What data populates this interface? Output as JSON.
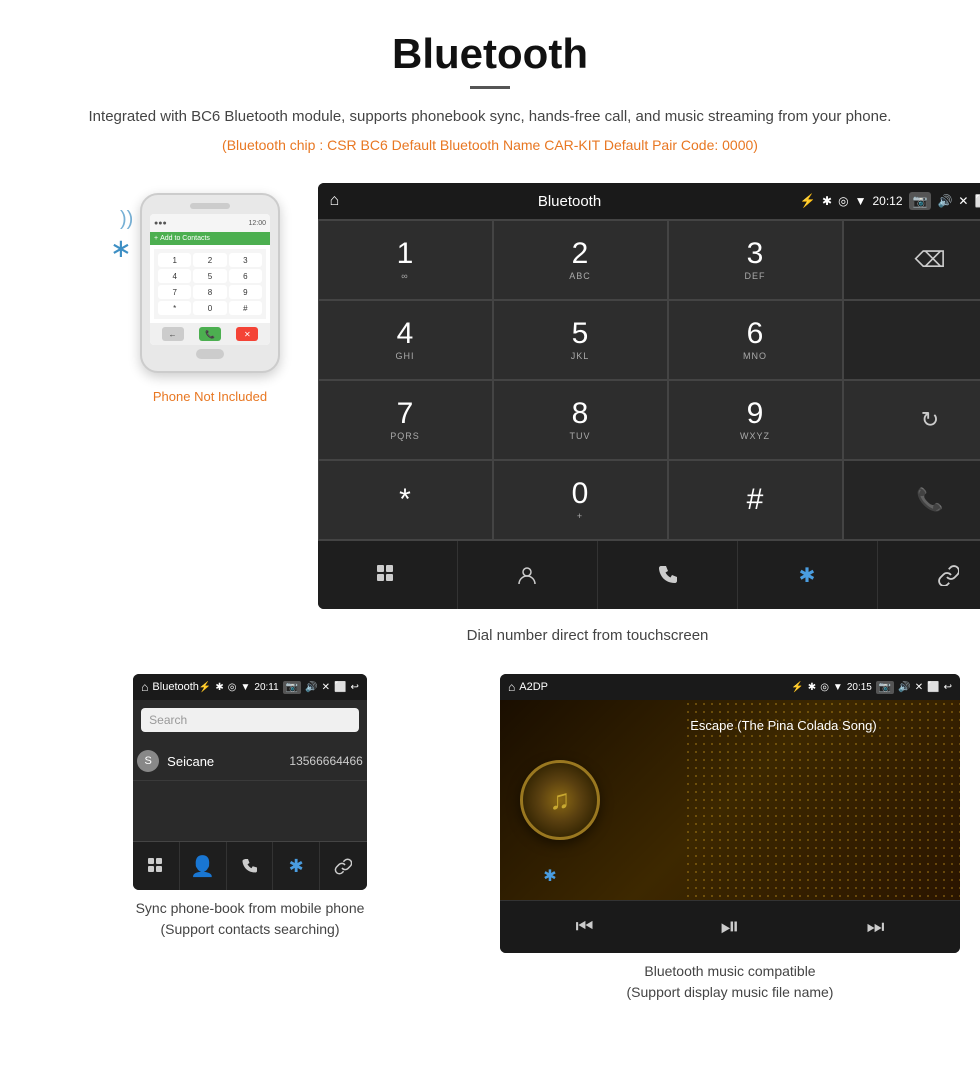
{
  "page": {
    "title": "Bluetooth",
    "description": "Integrated with BC6 Bluetooth module, supports phonebook sync, hands-free call, and music streaming from your phone.",
    "specs_line": "(Bluetooth chip : CSR BC6    Default Bluetooth Name CAR-KIT    Default Pair Code: 0000)"
  },
  "main_screen": {
    "status_bar": {
      "title": "Bluetooth",
      "time": "20:12",
      "usb_icon": "⚡",
      "back_icon": "↩"
    },
    "dialpad": [
      {
        "number": "1",
        "letters": "∞",
        "type": "digit"
      },
      {
        "number": "2",
        "letters": "ABC",
        "type": "digit"
      },
      {
        "number": "3",
        "letters": "DEF",
        "type": "digit"
      },
      {
        "number": "",
        "letters": "",
        "type": "empty"
      },
      {
        "number": "4",
        "letters": "GHI",
        "type": "digit"
      },
      {
        "number": "5",
        "letters": "JKL",
        "type": "digit"
      },
      {
        "number": "6",
        "letters": "MNO",
        "type": "digit"
      },
      {
        "number": "",
        "letters": "",
        "type": "empty"
      },
      {
        "number": "7",
        "letters": "PQRS",
        "type": "digit"
      },
      {
        "number": "8",
        "letters": "TUV",
        "type": "digit"
      },
      {
        "number": "9",
        "letters": "WXYZ",
        "type": "digit"
      },
      {
        "number": "",
        "letters": "",
        "type": "action_refresh"
      },
      {
        "number": "*",
        "letters": "",
        "type": "digit"
      },
      {
        "number": "0",
        "letters": "+",
        "type": "digit_plus"
      },
      {
        "number": "#",
        "letters": "",
        "type": "digit"
      },
      {
        "number": "",
        "letters": "",
        "type": "action_call_green"
      }
    ],
    "toolbar": [
      {
        "icon": "⠿",
        "name": "grid-icon"
      },
      {
        "icon": "👤",
        "name": "contact-icon"
      },
      {
        "icon": "📞",
        "name": "phone-icon"
      },
      {
        "icon": "✱",
        "name": "bluetooth-icon"
      },
      {
        "icon": "🔗",
        "name": "link-icon"
      }
    ],
    "caption": "Dial number direct from touchscreen"
  },
  "phone_mockup": {
    "not_included": "Phone Not Included"
  },
  "bottom_left": {
    "status_title": "Bluetooth",
    "time": "20:11",
    "search_placeholder": "Search",
    "contact_letter": "S",
    "contact_name": "Seicane",
    "contact_number": "13566664466",
    "caption_line1": "Sync phone-book from mobile phone",
    "caption_line2": "(Support contacts searching)"
  },
  "bottom_right": {
    "status_title": "A2DP",
    "time": "20:15",
    "song_title": "Escape (The Pina Colada Song)",
    "caption_line1": "Bluetooth music compatible",
    "caption_line2": "(Support display music file name)"
  },
  "colors": {
    "orange": "#e87722",
    "blue": "#3d8fc4",
    "green": "#4caf50",
    "red": "#f44336",
    "dark_bg": "#2a2a2a",
    "darker_bg": "#1a1a1a",
    "border": "#444"
  }
}
